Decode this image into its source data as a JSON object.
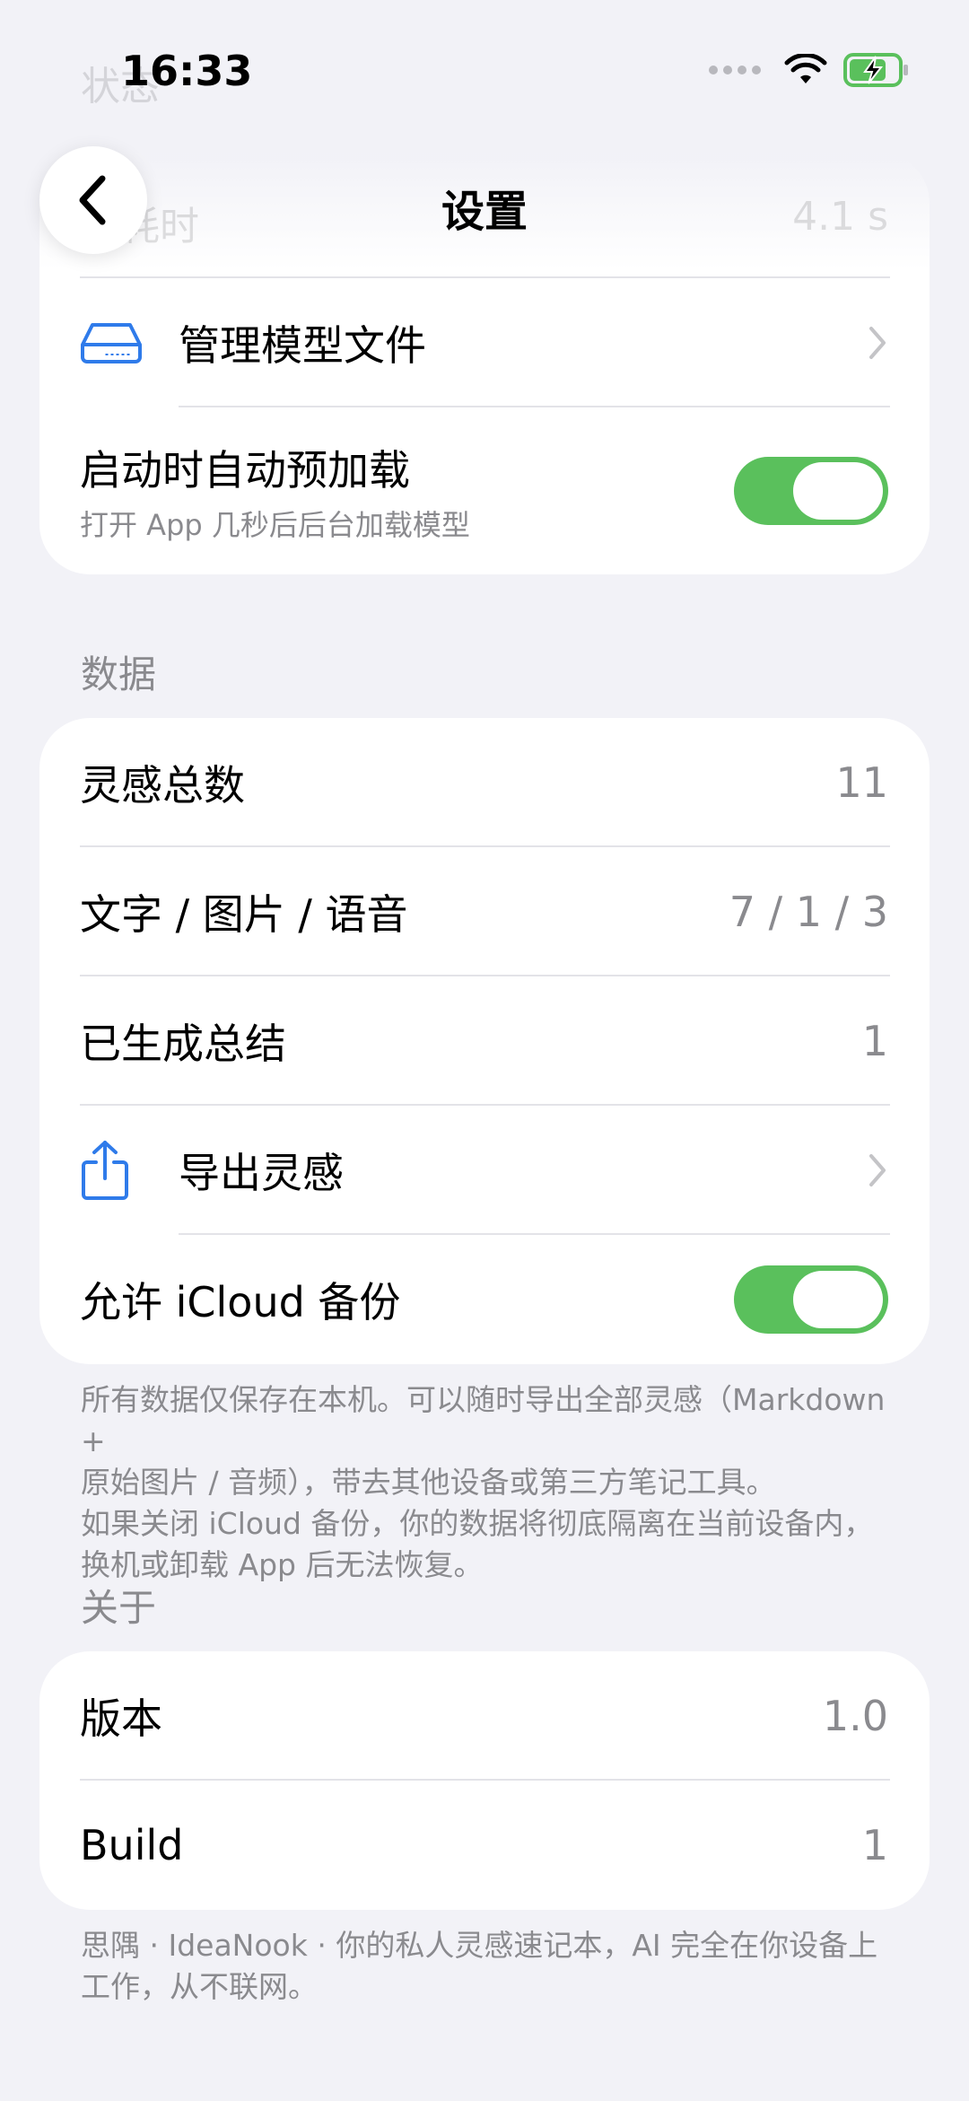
{
  "status_bar": {
    "time": "16:33"
  },
  "nav": {
    "title": "设置",
    "back_icon": "chevron-left-icon"
  },
  "faded": {
    "row1_label": "状态",
    "row2_label": "载耗时",
    "row2_value": "4.1 s"
  },
  "model_card": {
    "manage": {
      "label": "管理模型文件",
      "icon": "drive-icon"
    },
    "preload": {
      "label": "启动时自动预加载",
      "sublabel": "打开 App 几秒后后台加载模型",
      "enabled": true
    }
  },
  "data_section": {
    "header": "数据",
    "rows": [
      {
        "label": "灵感总数",
        "value": "11"
      },
      {
        "label": "文字 / 图片 / 语音",
        "value": "7 / 1 / 3"
      },
      {
        "label": "已生成总结",
        "value": "1"
      }
    ],
    "export": {
      "label": "导出灵感",
      "icon": "share-icon"
    },
    "icloud": {
      "label": "允许 iCloud 备份",
      "enabled": true
    },
    "footnote": [
      "所有数据仅保存在本机。可以随时导出全部灵感（Markdown +",
      "原始图片 / 音频），带去其他设备或第三方笔记工具。",
      "如果关闭 iCloud 备份，你的数据将彻底隔离在当前设备内，",
      "换机或卸载 App 后无法恢复。"
    ]
  },
  "about_section": {
    "header": "关于",
    "rows": [
      {
        "label": "版本",
        "value": "1.0"
      },
      {
        "label": "Build",
        "value": "1"
      }
    ],
    "footnote": [
      "思隅 · IdeaNook · 你的私人灵感速记本，AI 完全在你设备上",
      "工作，从不联网。"
    ]
  },
  "colors": {
    "accent_green": "#5ac05c",
    "icon_blue": "#2f7bea",
    "background": "#f2f2f7"
  }
}
